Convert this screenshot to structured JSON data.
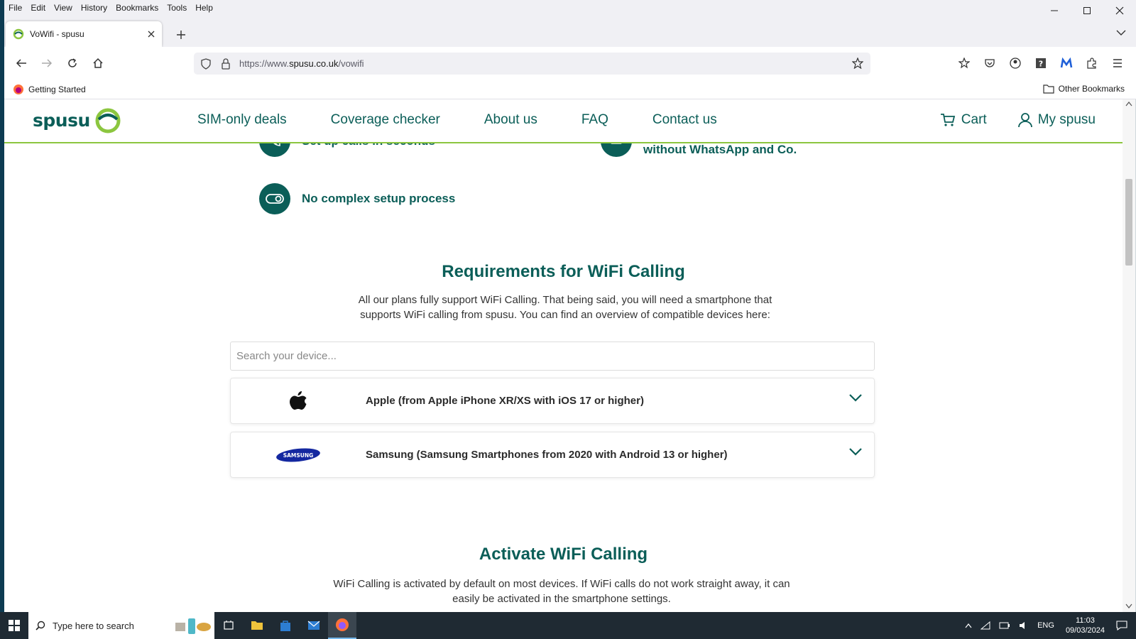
{
  "browser": {
    "menu": [
      "File",
      "Edit",
      "View",
      "History",
      "Bookmarks",
      "Tools",
      "Help"
    ],
    "tab_title": "VoWifi - spusu",
    "url_prefix": "https://www.",
    "url_domain": "spusu.co.uk",
    "url_path": "/vowifi",
    "bookmark_getting_started": "Getting Started",
    "other_bookmarks": "Other Bookmarks"
  },
  "site": {
    "logo_text": "spusu",
    "nav": [
      "SIM-only deals",
      "Coverage checker",
      "About us",
      "FAQ",
      "Contact us"
    ],
    "cart_label": "Cart",
    "account_label": "My spusu",
    "colors": {
      "brand": "#0b5e58",
      "accent": "#8cc63f"
    }
  },
  "features": {
    "item1": "Set up calls in seconds",
    "item2_line2": "without WhatsApp and Co.",
    "item3": "No complex setup process"
  },
  "requirements": {
    "title": "Requirements for WiFi Calling",
    "text": "All our plans fully support WiFi Calling. That being said, you will need a smartphone that supports WiFi calling from spusu. You can find an overview of compatible devices here:",
    "search_placeholder": "Search your device...",
    "devices": [
      {
        "logo": "apple-logo",
        "label": "Apple (from Apple iPhone XR/XS with iOS 17 or higher)"
      },
      {
        "logo": "samsung-logo",
        "logo_text": "SAMSUNG",
        "label": "Samsung (Samsung Smartphones from 2020 with Android 13 or higher)"
      }
    ]
  },
  "activate": {
    "title": "Activate WiFi Calling",
    "text": "WiFi Calling is activated by default on most devices. If WiFi calls do not work straight away, it can easily be activated in the smartphone settings."
  },
  "taskbar": {
    "search_placeholder": "Type here to search",
    "lang": "ENG",
    "time": "11:03",
    "date": "09/03/2024"
  }
}
